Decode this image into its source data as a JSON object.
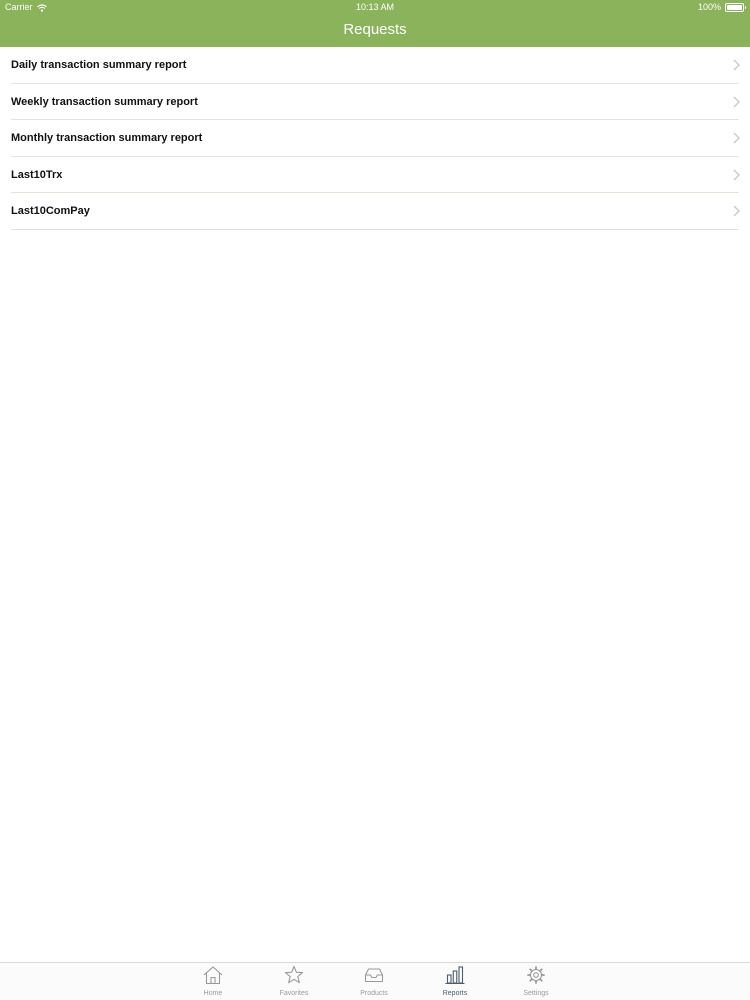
{
  "status_bar": {
    "carrier": "Carrier",
    "time": "10:13 AM",
    "battery": "100%"
  },
  "nav": {
    "title": "Requests"
  },
  "requests": [
    {
      "label": "Daily transaction summary report"
    },
    {
      "label": "Weekly transaction summary report"
    },
    {
      "label": "Monthly transaction summary report"
    },
    {
      "label": "Last10Trx"
    },
    {
      "label": "Last10ComPay"
    }
  ],
  "tabs": [
    {
      "label": "Home",
      "icon": "home-icon"
    },
    {
      "label": "Favorites",
      "icon": "star-icon"
    },
    {
      "label": "Products",
      "icon": "inbox-icon"
    },
    {
      "label": "Reports",
      "icon": "bar-chart-icon",
      "active": true
    },
    {
      "label": "Settings",
      "icon": "gear-icon"
    }
  ],
  "colors": {
    "nav_bar": "#8ab35c",
    "active_tab": "#4a5c6e",
    "inactive_tab": "#9a9a9a"
  }
}
